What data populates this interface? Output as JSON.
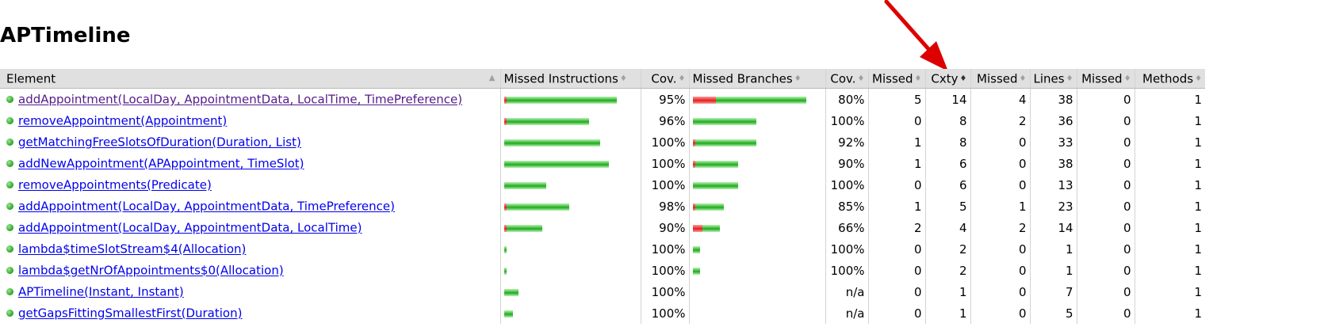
{
  "title": "APTimeline",
  "header": {
    "element": "Element",
    "missed_instructions": "Missed Instructions",
    "cov1": "Cov.",
    "missed_branches": "Missed Branches",
    "cov2": "Cov.",
    "missed_cxty": "Missed",
    "cxty": "Cxty",
    "missed_lines": "Missed",
    "lines": "Lines",
    "missed_methods": "Missed",
    "methods": "Methods"
  },
  "colors": {
    "covered": "#20a820",
    "missed": "#e02020",
    "header_bg": "#e0e0e0",
    "arrow": "#dd0000"
  },
  "rows": [
    {
      "name": "addAppointment(LocalDay, AppointmentData, LocalTime, TimePreference)",
      "visited": true,
      "instr_missed_frac": 0.02,
      "instr_total_rel": 1.0,
      "instr_cov": "95%",
      "br_missed_frac": 0.2,
      "br_total_rel": 1.0,
      "br_cov": "80%",
      "missed_cxty": "5",
      "cxty": "14",
      "missed_lines": "4",
      "lines": "38",
      "missed_methods": "0",
      "methods": "1"
    },
    {
      "name": "removeAppointment(Appointment)",
      "visited": false,
      "instr_missed_frac": 0.02,
      "instr_total_rel": 0.75,
      "instr_cov": "96%",
      "br_missed_frac": 0.0,
      "br_total_rel": 0.56,
      "br_cov": "100%",
      "missed_cxty": "0",
      "cxty": "8",
      "missed_lines": "2",
      "lines": "36",
      "missed_methods": "0",
      "methods": "1"
    },
    {
      "name": "getMatchingFreeSlotsOfDuration(Duration, List)",
      "visited": false,
      "instr_missed_frac": 0.0,
      "instr_total_rel": 0.85,
      "instr_cov": "100%",
      "br_missed_frac": 0.02,
      "br_total_rel": 0.56,
      "br_cov": "92%",
      "missed_cxty": "1",
      "cxty": "8",
      "missed_lines": "0",
      "lines": "33",
      "missed_methods": "0",
      "methods": "1"
    },
    {
      "name": "addNewAppointment(APAppointment, TimeSlot)",
      "visited": false,
      "instr_missed_frac": 0.0,
      "instr_total_rel": 0.93,
      "instr_cov": "100%",
      "br_missed_frac": 0.04,
      "br_total_rel": 0.4,
      "br_cov": "90%",
      "missed_cxty": "1",
      "cxty": "6",
      "missed_lines": "0",
      "lines": "38",
      "missed_methods": "0",
      "methods": "1"
    },
    {
      "name": "removeAppointments(Predicate)",
      "visited": false,
      "instr_missed_frac": 0.0,
      "instr_total_rel": 0.37,
      "instr_cov": "100%",
      "br_missed_frac": 0.0,
      "br_total_rel": 0.4,
      "br_cov": "100%",
      "missed_cxty": "0",
      "cxty": "6",
      "missed_lines": "0",
      "lines": "13",
      "missed_methods": "0",
      "methods": "1"
    },
    {
      "name": "addAppointment(LocalDay, AppointmentData, TimePreference)",
      "visited": false,
      "instr_missed_frac": 0.02,
      "instr_total_rel": 0.58,
      "instr_cov": "98%",
      "br_missed_frac": 0.05,
      "br_total_rel": 0.27,
      "br_cov": "85%",
      "missed_cxty": "1",
      "cxty": "5",
      "missed_lines": "1",
      "lines": "23",
      "missed_methods": "0",
      "methods": "1"
    },
    {
      "name": "addAppointment(LocalDay, AppointmentData, LocalTime)",
      "visited": false,
      "instr_missed_frac": 0.06,
      "instr_total_rel": 0.34,
      "instr_cov": "90%",
      "br_missed_frac": 0.36,
      "br_total_rel": 0.24,
      "br_cov": "66%",
      "missed_cxty": "2",
      "cxty": "4",
      "missed_lines": "2",
      "lines": "14",
      "missed_methods": "0",
      "methods": "1"
    },
    {
      "name": "lambda$timeSlotStream$4(Allocation)",
      "visited": false,
      "instr_missed_frac": 0.0,
      "instr_total_rel": 0.015,
      "instr_cov": "100%",
      "br_missed_frac": 0.0,
      "br_total_rel": 0.06,
      "br_cov": "100%",
      "missed_cxty": "0",
      "cxty": "2",
      "missed_lines": "0",
      "lines": "1",
      "missed_methods": "0",
      "methods": "1"
    },
    {
      "name": "lambda$getNrOfAppointments$0(Allocation)",
      "visited": false,
      "instr_missed_frac": 0.0,
      "instr_total_rel": 0.015,
      "instr_cov": "100%",
      "br_missed_frac": 0.0,
      "br_total_rel": 0.06,
      "br_cov": "100%",
      "missed_cxty": "0",
      "cxty": "2",
      "missed_lines": "0",
      "lines": "1",
      "missed_methods": "0",
      "methods": "1"
    },
    {
      "name": "APTimeline(Instant, Instant)",
      "visited": false,
      "instr_missed_frac": 0.0,
      "instr_total_rel": 0.13,
      "instr_cov": "100%",
      "br_missed_frac": 0.0,
      "br_total_rel": 0.0,
      "br_cov": "n/a",
      "missed_cxty": "0",
      "cxty": "1",
      "missed_lines": "0",
      "lines": "7",
      "missed_methods": "0",
      "methods": "1"
    },
    {
      "name": "getGapsFittingSmallestFirst(Duration)",
      "visited": false,
      "instr_missed_frac": 0.0,
      "instr_total_rel": 0.08,
      "instr_cov": "100%",
      "br_missed_frac": 0.0,
      "br_total_rel": 0.0,
      "br_cov": "n/a",
      "missed_cxty": "0",
      "cxty": "1",
      "missed_lines": "0",
      "lines": "5",
      "missed_methods": "0",
      "methods": "1"
    }
  ]
}
